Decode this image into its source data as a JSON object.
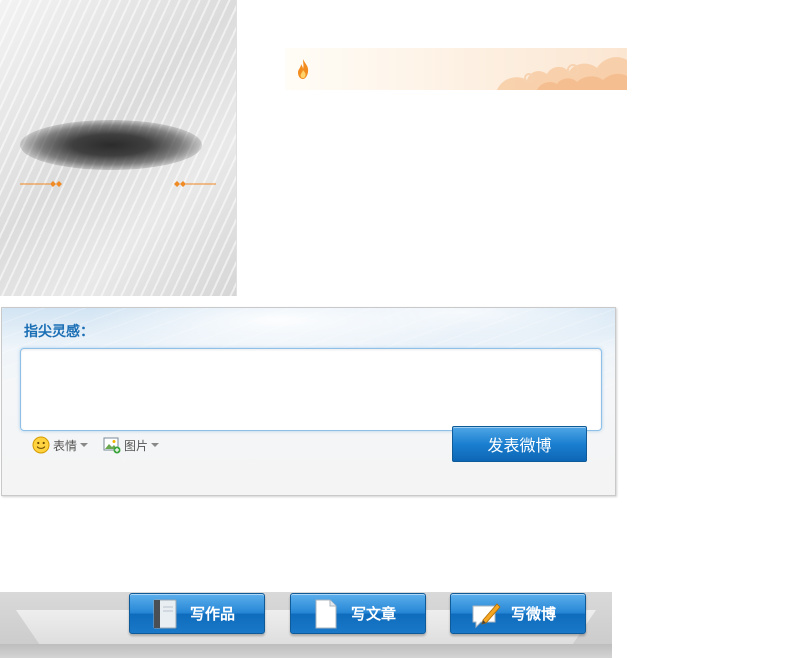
{
  "post": {
    "title": "指尖灵感：",
    "input_value": "",
    "emoji_label": "表情",
    "image_label": "图片",
    "publish_label": "发表微博"
  },
  "actions": {
    "write_works": "写作品",
    "write_article": "写文章",
    "write_weibo": "写微博"
  },
  "icons": {
    "banner": "flame-icon",
    "emoji": "smiley-icon",
    "image": "picture-icon",
    "works": "book-icon",
    "article": "document-icon",
    "weibo": "speech-pencil-icon"
  },
  "colors": {
    "accent_blue": "#1b6fb5",
    "button_blue": "#1b7fd0",
    "ornament_orange": "#f08a24"
  }
}
